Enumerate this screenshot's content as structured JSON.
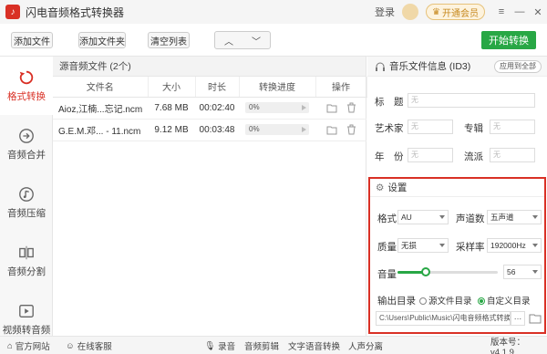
{
  "app": {
    "title": "闪电音频格式转换器",
    "logo_glyph": "♪"
  },
  "titlebar": {
    "login": "登录",
    "vip": "开通会员"
  },
  "toolbar": {
    "add_file": "添加文件",
    "add_folder": "添加文件夹",
    "clear_list": "清空列表",
    "up": "︿",
    "down": "﹀",
    "start": "开始转换"
  },
  "sidebar": {
    "items": [
      {
        "label": "格式转换",
        "icon": "refresh-icon",
        "active": true
      },
      {
        "label": "音频合并",
        "icon": "merge-icon"
      },
      {
        "label": "音频压缩",
        "icon": "compress-icon"
      },
      {
        "label": "音频分割",
        "icon": "split-icon"
      },
      {
        "label": "视频转音频",
        "icon": "video-icon"
      }
    ]
  },
  "filepanel": {
    "header": "源音频文件 (2个)",
    "columns": [
      "文件名",
      "大小",
      "时长",
      "转换进度",
      "操作"
    ],
    "rows": [
      {
        "name": "Aioz,江楠...忘记.ncm",
        "size": "7.68 MB",
        "duration": "00:02:40",
        "progress": "0%"
      },
      {
        "name": "G.E.M.邓... - 11.ncm",
        "size": "9.12 MB",
        "duration": "00:03:48",
        "progress": "0%"
      }
    ]
  },
  "info": {
    "header": "音乐文件信息 (ID3)",
    "apply_all": "应用到全部",
    "title_label": "标　题",
    "artist_label": "艺术家",
    "album_label": "专辑",
    "year_label": "年　份",
    "genre_label": "流派",
    "empty": "无"
  },
  "settings": {
    "header": "设置",
    "format_label": "格式",
    "format_value": "AU",
    "channels_label": "声道数",
    "channels_value": "五声道",
    "quality_label": "质量",
    "quality_value": "无损",
    "samplerate_label": "采样率",
    "samplerate_value": "192000Hz",
    "volume_label": "音量",
    "volume_value": "56",
    "volume_fraction": 0.28,
    "output_label": "输出目录",
    "source_dir": "源文件目录",
    "custom_dir": "自定义目录",
    "path": "C:\\Users\\Public\\Music\\闪电音频格式转换",
    "more": "···"
  },
  "statusbar": {
    "website": "官方网站",
    "service": "在线客服",
    "record": "录音",
    "cut": "音频剪辑",
    "tts": "文字语音转换",
    "separate": "人声分离",
    "version": "版本号：v4.1.9"
  },
  "colors": {
    "accent": "#d93025",
    "green": "#28a745"
  }
}
